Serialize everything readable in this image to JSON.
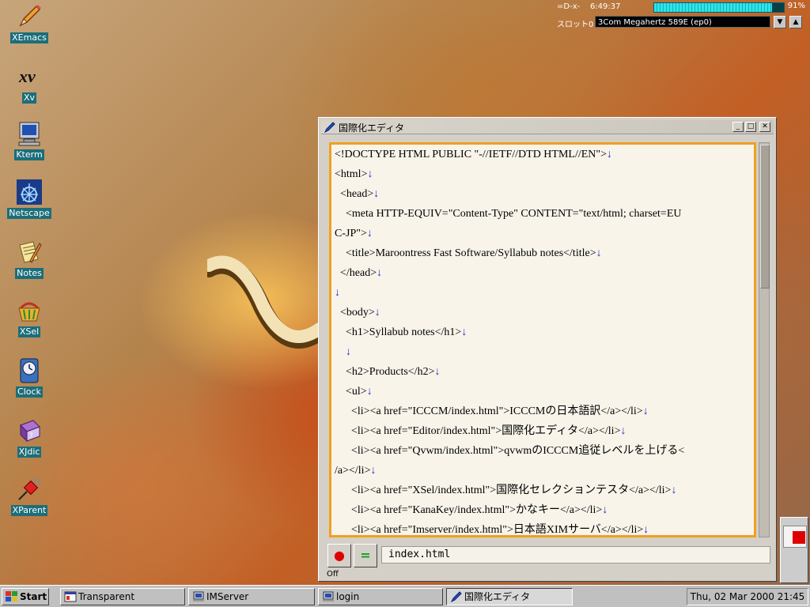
{
  "desktop": {
    "icons": [
      {
        "label": "XEmacs"
      },
      {
        "label": "Xv"
      },
      {
        "label": "Kterm"
      },
      {
        "label": "Netscape"
      },
      {
        "label": "Notes"
      },
      {
        "label": "XSel"
      },
      {
        "label": "Clock"
      },
      {
        "label": "XJdic"
      },
      {
        "label": "XParent"
      }
    ]
  },
  "status": {
    "apm": "=D-x-",
    "time": "6:49:37",
    "battery_percent": "91%",
    "battery_level": 0.91,
    "slot_label": "スロット0",
    "card": "3Com Megahertz 589E (ep0)"
  },
  "editor": {
    "title": "国際化エディタ",
    "lines": [
      {
        "text": "<!DOCTYPE HTML PUBLIC \"-//IETF//DTD HTML//EN\">",
        "nl": "↓"
      },
      {
        "text": "<html>",
        "nl": "↓"
      },
      {
        "text": "  <head>",
        "nl": "↓"
      },
      {
        "text": "    <meta HTTP-EQUIV=\"Content-Type\" CONTENT=\"text/html; charset=EU",
        "nl": ""
      },
      {
        "text": "C-JP\">",
        "nl": "↓"
      },
      {
        "text": "    <title>Maroontress Fast Software/Syllabub notes</title>",
        "nl": "↓"
      },
      {
        "text": "  </head>",
        "nl": "↓"
      },
      {
        "text": "",
        "nl": "↓"
      },
      {
        "text": "  <body>",
        "nl": "↓"
      },
      {
        "text": "    <h1>Syllabub notes</h1>",
        "nl": "↓"
      },
      {
        "text": "    ",
        "nl": "↓"
      },
      {
        "text": "    <h2>Products</h2>",
        "nl": "↓"
      },
      {
        "text": "    <ul>",
        "nl": "↓"
      },
      {
        "text": "      <li><a href=\"ICCCM/index.html\">ICCCMの日本語訳</a></li>",
        "nl": "↓"
      },
      {
        "text": "      <li><a href=\"Editor/index.html\">国際化エディタ</a></li>",
        "nl": "↓"
      },
      {
        "text": "      <li><a href=\"Qvwm/index.html\">qvwmのICCCM追従レベルを上げる<",
        "nl": ""
      },
      {
        "text": "/a></li>",
        "nl": "↓"
      },
      {
        "text": "      <li><a href=\"XSel/index.html\">国際化セレクションテスタ</a></li>",
        "nl": "↓"
      },
      {
        "text": "      <li><a href=\"KanaKey/index.html\">かなキー</a></li>",
        "nl": "↓"
      },
      {
        "text": "      <li><a href=\"Imserver/index.html\">日本語XIMサーバ</a></li>",
        "nl": "↓"
      }
    ],
    "filename": "index.html",
    "state": "Off",
    "record_label": "●",
    "equal_label": "="
  },
  "taskbar": {
    "start": "Start",
    "tasks": [
      {
        "label": "Transparent"
      },
      {
        "label": "IMServer"
      },
      {
        "label": "login"
      },
      {
        "label": "国際化エディタ"
      }
    ],
    "clock": "Thu, 02 Mar 2000 21:45"
  }
}
